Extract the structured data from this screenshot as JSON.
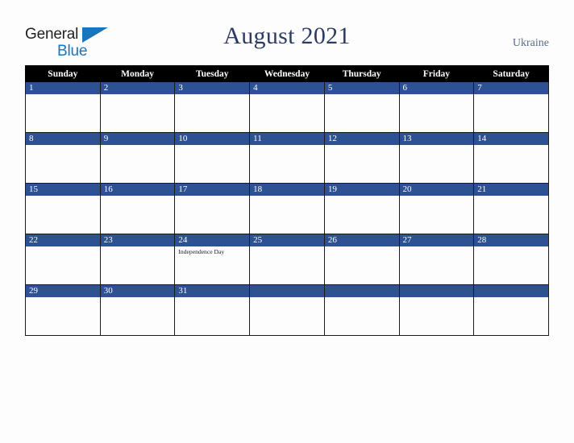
{
  "brand": {
    "name_part1": "General",
    "name_part2": "Blue",
    "triangle_icon": "triangle-icon",
    "color_dark": "#231f20",
    "color_blue": "#1b75bc"
  },
  "header": {
    "title": "August 2021",
    "country": "Ukraine",
    "title_color": "#2c3b62",
    "country_color": "#5b6a8c"
  },
  "calendar": {
    "weekday_headers": [
      "Sunday",
      "Monday",
      "Tuesday",
      "Wednesday",
      "Thursday",
      "Friday",
      "Saturday"
    ],
    "header_bg": "#000000",
    "header_text": "#ffffff",
    "date_band_bg": "#2d5193",
    "date_band_text": "#ffffff",
    "cell_bg": "#fdfdfd",
    "border_color": "#1a1a1a",
    "weeks": [
      [
        {
          "day": "1",
          "events": []
        },
        {
          "day": "2",
          "events": []
        },
        {
          "day": "3",
          "events": []
        },
        {
          "day": "4",
          "events": []
        },
        {
          "day": "5",
          "events": []
        },
        {
          "day": "6",
          "events": []
        },
        {
          "day": "7",
          "events": []
        }
      ],
      [
        {
          "day": "8",
          "events": []
        },
        {
          "day": "9",
          "events": []
        },
        {
          "day": "10",
          "events": []
        },
        {
          "day": "11",
          "events": []
        },
        {
          "day": "12",
          "events": []
        },
        {
          "day": "13",
          "events": []
        },
        {
          "day": "14",
          "events": []
        }
      ],
      [
        {
          "day": "15",
          "events": []
        },
        {
          "day": "16",
          "events": []
        },
        {
          "day": "17",
          "events": []
        },
        {
          "day": "18",
          "events": []
        },
        {
          "day": "19",
          "events": []
        },
        {
          "day": "20",
          "events": []
        },
        {
          "day": "21",
          "events": []
        }
      ],
      [
        {
          "day": "22",
          "events": []
        },
        {
          "day": "23",
          "events": []
        },
        {
          "day": "24",
          "events": [
            "Independence Day"
          ]
        },
        {
          "day": "25",
          "events": []
        },
        {
          "day": "26",
          "events": []
        },
        {
          "day": "27",
          "events": []
        },
        {
          "day": "28",
          "events": []
        }
      ],
      [
        {
          "day": "29",
          "events": []
        },
        {
          "day": "30",
          "events": []
        },
        {
          "day": "31",
          "events": []
        },
        {
          "day": "",
          "events": []
        },
        {
          "day": "",
          "events": []
        },
        {
          "day": "",
          "events": []
        },
        {
          "day": "",
          "events": []
        }
      ]
    ]
  }
}
